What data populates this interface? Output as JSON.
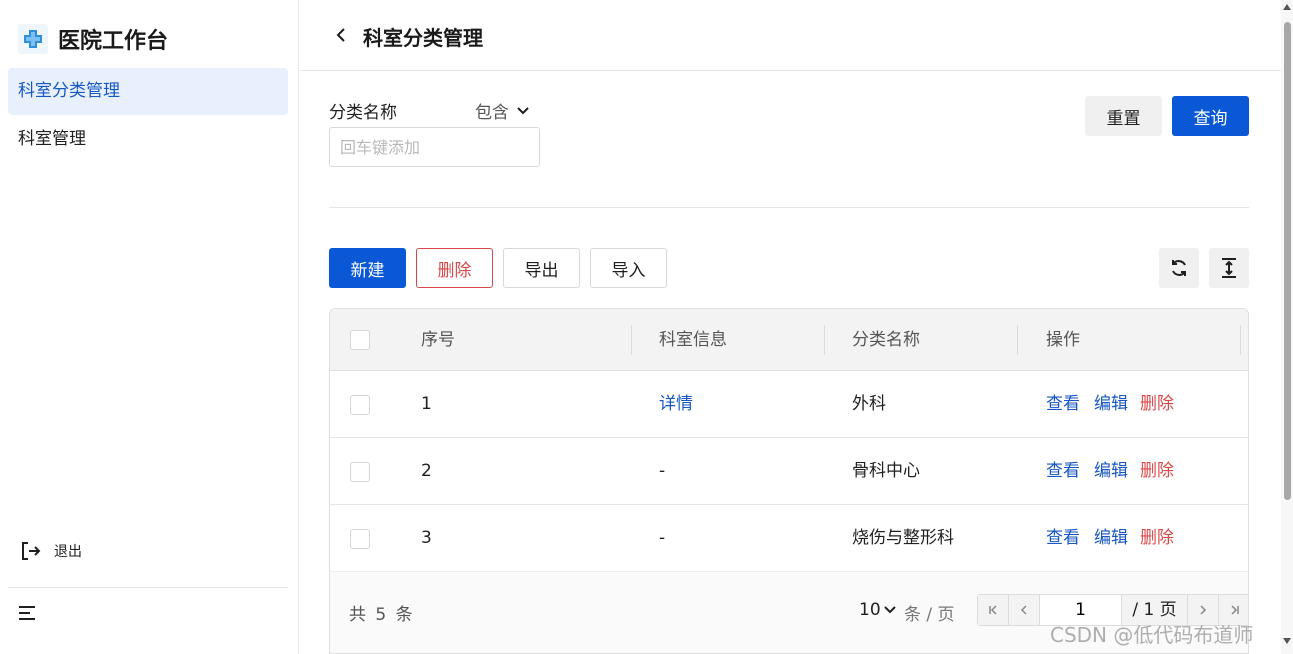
{
  "app": {
    "title": "医院工作台",
    "logo_icon": "hospital-cross-icon",
    "accent": "#0b58d6"
  },
  "sidebar": {
    "items": [
      {
        "label": "科室分类管理",
        "active": true
      },
      {
        "label": "科室管理",
        "active": false
      }
    ],
    "logout_label": "退出"
  },
  "header": {
    "title": "科室分类管理"
  },
  "filter": {
    "field_label": "分类名称",
    "operator": "包含",
    "input_placeholder": "回车键添加",
    "reset_label": "重置",
    "query_label": "查询"
  },
  "toolbar": {
    "new_label": "新建",
    "delete_label": "删除",
    "export_label": "导出",
    "import_label": "导入"
  },
  "table": {
    "columns": [
      "序号",
      "科室信息",
      "分类名称",
      "操作"
    ],
    "rows": [
      {
        "index": "1",
        "info": "详情",
        "info_is_link": true,
        "category": "外科",
        "actions": [
          "查看",
          "编辑",
          "删除"
        ]
      },
      {
        "index": "2",
        "info": "-",
        "info_is_link": false,
        "category": "骨科中心",
        "actions": [
          "查看",
          "编辑",
          "删除"
        ]
      },
      {
        "index": "3",
        "info": "-",
        "info_is_link": false,
        "category": "烧伤与整形科",
        "actions": [
          "查看",
          "编辑",
          "删除"
        ]
      }
    ]
  },
  "pagination": {
    "total_text": "共 5 条",
    "page_size": "10",
    "page_size_unit": "条 / 页",
    "current_page": "1",
    "total_pages_text": "/ 1 页"
  },
  "watermark": "CSDN @低代码布道师"
}
